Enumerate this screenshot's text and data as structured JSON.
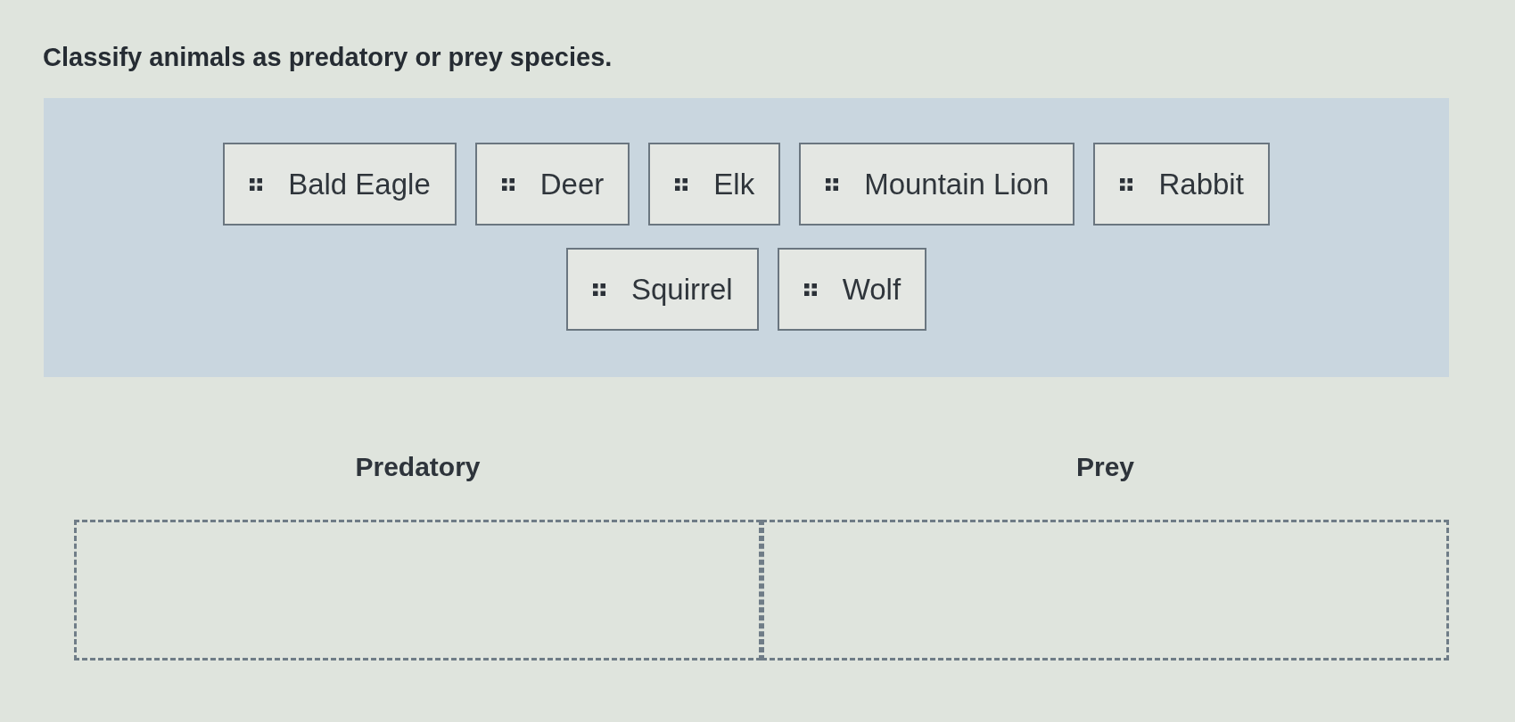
{
  "prompt": "Classify animals as predatory or prey species.",
  "item_rows": [
    [
      "Bald Eagle",
      "Deer",
      "Elk",
      "Mountain Lion",
      "Rabbit"
    ],
    [
      "Squirrel",
      "Wolf"
    ]
  ],
  "categories": [
    {
      "heading": "Predatory"
    },
    {
      "heading": "Prey"
    }
  ]
}
